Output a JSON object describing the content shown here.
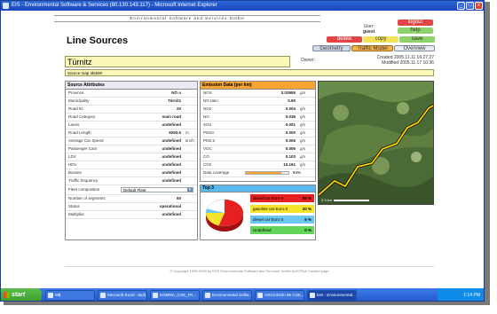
{
  "window": {
    "title": "EIS - Environmental Software & Services (80.130.143.117) - Microsoft Internet Explorer",
    "min_glyph": "_",
    "max_glyph": "□",
    "close_glyph": "x"
  },
  "page": {
    "banner": "Environmental Software and Services GmbH",
    "title": "Line Sources",
    "user_label": "User:",
    "user_name": "guest"
  },
  "buttons": {
    "logout": "logout",
    "help": "help",
    "delete": "delete",
    "copy": "copy",
    "save": "save",
    "geometry": "Geometry",
    "traffic_model": "Traffic Model",
    "overview": "Overview"
  },
  "source": {
    "name": "Türnitz",
    "owner_label": "Owner:",
    "created": "Created 2005.11.11 16:27:27",
    "modified": "Modified 2005.11.17 10:36",
    "source_text": "Source map Ids600"
  },
  "attributes": {
    "header": "Source Attributes",
    "rows": [
      {
        "label": "Province",
        "value": "NÖ u",
        "unit": ""
      },
      {
        "label": "Municipality",
        "value": "Türnitz",
        "unit": ""
      },
      {
        "label": "Road ID",
        "value": "20",
        "unit": ""
      },
      {
        "label": "Road Category",
        "value": "main road",
        "unit": ""
      },
      {
        "label": "Lanes",
        "value": "undefined",
        "unit": ""
      },
      {
        "label": "Road Length",
        "value": "9293.5",
        "unit": "m"
      },
      {
        "label": "Average Car Speed",
        "value": "undefined",
        "unit": "km/h"
      },
      {
        "label": "Passenger Cars",
        "value": "undefined",
        "unit": ""
      },
      {
        "label": "LDV",
        "value": "undefined",
        "unit": ""
      },
      {
        "label": "HDV",
        "value": "undefined",
        "unit": ""
      },
      {
        "label": "Busses",
        "value": "undefined",
        "unit": ""
      },
      {
        "label": "Traffic frequency",
        "value": "undefined",
        "unit": ""
      }
    ],
    "fleet_label": "Fleet composition",
    "fleet_value": "Default Fleet",
    "rows2": [
      {
        "label": "Number of segments",
        "value": "60",
        "unit": ""
      },
      {
        "label": "Status",
        "value": "operational",
        "unit": ""
      },
      {
        "label": "Multiplier",
        "value": "undefined",
        "unit": ""
      }
    ]
  },
  "emissions": {
    "header": "Emission Data (per km)",
    "rows": [
      {
        "label": "NOX",
        "value": "0.03955",
        "unit": "g/s"
      },
      {
        "label": "NO ratio",
        "value": "0.90",
        "unit": ""
      },
      {
        "label": "NO2",
        "value": "0.004",
        "unit": "g/s"
      },
      {
        "label": "NO",
        "value": "0.036",
        "unit": "g/s"
      },
      {
        "label": "SO2",
        "value": "0.001",
        "unit": "g/s"
      },
      {
        "label": "PM10",
        "value": "0.000",
        "unit": "g/s"
      },
      {
        "label": "PM2.5",
        "value": "0.006",
        "unit": "g/s"
      },
      {
        "label": "VOC",
        "value": "0.006",
        "unit": "g/s"
      },
      {
        "label": "CO",
        "value": "0.103",
        "unit": "g/s"
      },
      {
        "label": "CO2",
        "value": "15.161",
        "unit": "g/s"
      }
    ],
    "coverage_label": "Data coverage",
    "coverage_pct": 84,
    "coverage_text": "84%"
  },
  "top3": {
    "header": "Top 3",
    "items": [
      {
        "name": "diesel car Euro-4",
        "pct": 55,
        "pct_text": "55 %",
        "color": "#e62020"
      },
      {
        "name": "gasoline car Euro-3",
        "pct": 20,
        "pct_text": "20 %",
        "color": "#f5e42a"
      },
      {
        "name": "diesel car Euro-3",
        "pct": 5,
        "pct_text": "5 %",
        "color": "#6ac6f2"
      },
      {
        "name": "Undefined",
        "pct": 0,
        "pct_text": "0 %",
        "color": "#62d45a"
      }
    ],
    "remainder_color": "#ffffff"
  },
  "map": {
    "scale_text": "0.3 km"
  },
  "footer": "© Copyright 1995-2005 by ESS Environmental Software and Services GmbH AUSTRIA Cached page",
  "taskbar": {
    "start": "start",
    "tasks": [
      "M$",
      "Microsoft Excel - lauft...",
      "KOMMA_COE_PA...",
      "Environmental Softw...",
      "AGC/Airinfo 85 CO5...",
      "EIS - Environmental..."
    ],
    "clock": "1:14 PM"
  },
  "colors": {
    "accent_orange": "#f6a534",
    "top3_blue": "#59b8ec",
    "name_yellow": "#fbf7b8",
    "road_yellow": "#ffd400"
  }
}
